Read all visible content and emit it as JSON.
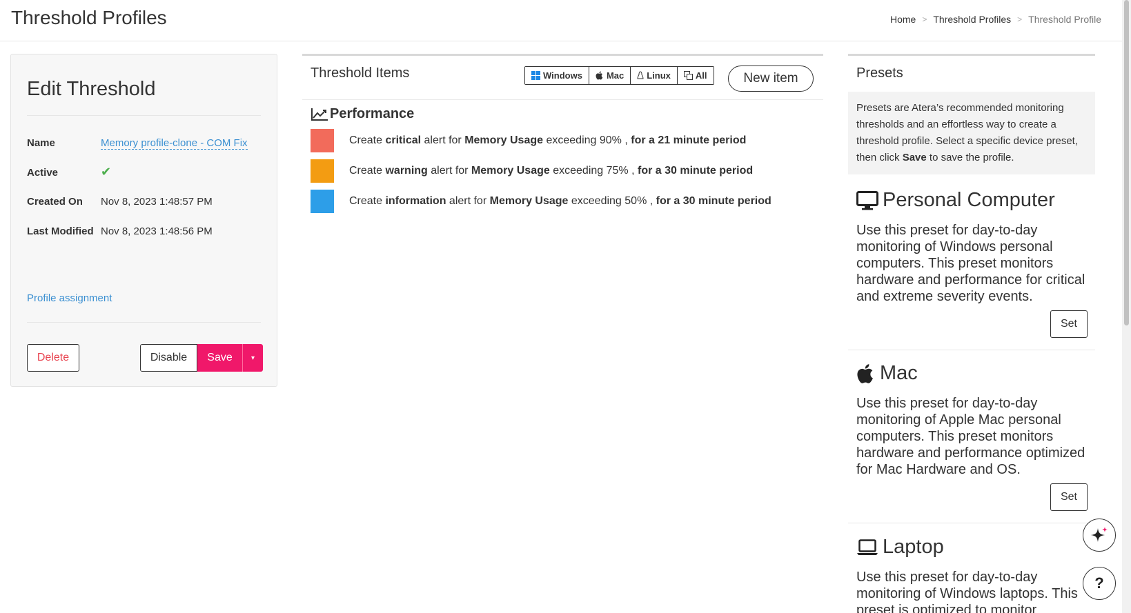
{
  "header": {
    "title": "Threshold Profiles",
    "breadcrumb": [
      "Home",
      "Threshold Profiles",
      "Threshold Profile"
    ],
    "separator": ">"
  },
  "edit": {
    "title": "Edit Threshold",
    "name_label": "Name",
    "name_value": "Memory profile-clone - COM Fix",
    "active_label": "Active",
    "active_check": "✔",
    "created_label": "Created On",
    "created_value": "Nov 8, 2023 1:48:57 PM",
    "modified_label": "Last Modified",
    "modified_value": "Nov 8, 2023 1:48:56 PM",
    "profile_assignment": "Profile assignment",
    "delete_label": "Delete",
    "disable_label": "Disable",
    "save_label": "Save",
    "caret": "▾"
  },
  "items": {
    "title": "Threshold Items",
    "os_filters": [
      "Windows",
      "Mac",
      "Linux",
      "All"
    ],
    "new_item_label": "New item",
    "section": "Performance",
    "alerts": [
      {
        "color": "#f26b5b",
        "pre": "Create ",
        "level": "critical",
        "mid": " alert for ",
        "metric": "Memory Usage",
        "exceed": " exceeding 90% , ",
        "period": "for a 21 minute period"
      },
      {
        "color": "#f39c12",
        "pre": "Create ",
        "level": "warning",
        "mid": " alert for ",
        "metric": "Memory Usage",
        "exceed": " exceeding 75% , ",
        "period": "for a 30 minute period"
      },
      {
        "color": "#2d9ee8",
        "pre": "Create ",
        "level": "information",
        "mid": " alert for ",
        "metric": "Memory Usage",
        "exceed": " exceeding 50% , ",
        "period": "for a 30 minute period"
      }
    ]
  },
  "presets": {
    "title": "Presets",
    "intro_pre": "Presets are Atera’s recommended monitoring thresholds and an effortless way to create a threshold profile. Select a specific device preset, then click ",
    "intro_bold": "Save",
    "intro_post": " to save the profile.",
    "set_label": "Set",
    "list": [
      {
        "name": "Personal Computer",
        "icon": "monitor-icon",
        "desc": "Use this preset for day-to-day monitoring of Windows personal computers. This preset monitors hardware and performance for critical and extreme severity events."
      },
      {
        "name": "Mac",
        "icon": "apple-icon",
        "desc": "Use this preset for day-to-day monitoring of Apple Mac personal computers. This preset monitors hardware and performance optimized for Mac Hardware and OS."
      },
      {
        "name": "Laptop",
        "icon": "laptop-icon",
        "desc": "Use this preset for day-to-day monitoring of Windows laptops. This preset is optimized to monitor"
      }
    ]
  },
  "help": {
    "label": "?"
  },
  "colors": {
    "accent": "#f0186a",
    "link": "#3a8fd1",
    "check": "#4cae4c"
  }
}
